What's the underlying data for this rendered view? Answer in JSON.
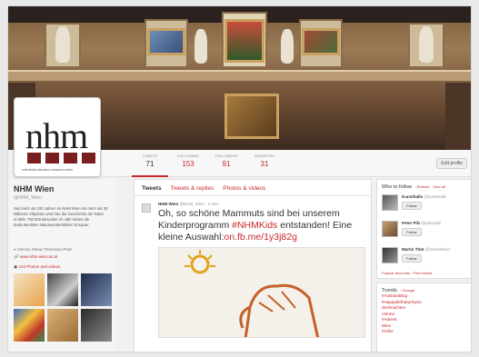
{
  "header": {
    "photo": "museum-hall-header-photo"
  },
  "logo": {
    "text": "nhm",
    "tagline": "naturhistorisches museum wien"
  },
  "stats": [
    {
      "label": "Tweets",
      "value": "71"
    },
    {
      "label": "Following",
      "value": "153"
    },
    {
      "label": "Followers",
      "value": "91"
    },
    {
      "label": "Favorites",
      "value": "31"
    }
  ],
  "edit_profile_label": "Edit profile",
  "profile": {
    "name": "NHM Wien",
    "handle": "@NHM_Wien",
    "bio": "Seit mehr als 100 Jahren im NHM Wien mit mehr als 30 Millionen Objekten wird hier die Geschichte der Natur erzählt. 750.000 Besucher im Jahr testen die bedeutendsten Naturwunderstätten Europas.",
    "location": "Vienna, Maria-Theresien-Platz",
    "website": "www.nhm-wien.ac.at",
    "media_link": "153 Photos and videos"
  },
  "tabs": [
    "Tweets",
    "Tweets & replies",
    "Photos & videos"
  ],
  "tweet": {
    "author": "NHM Wien",
    "handle": "@NHM_Wien · 5 Dec",
    "text_before": "Oh, so schöne Mammuts sind bei unserem Kinderprogramm ",
    "hashtag": "#NHMKids",
    "text_middle": " entstanden! Eine kleine Auswahl:",
    "link": "on.fb.me/1y3j82g"
  },
  "who_to_follow": {
    "title": "Who to follow",
    "actions": "· Refresh · View all",
    "follow_label": "Follow",
    "items": [
      {
        "name": "Kunsthalle",
        "handle": "@kunsthalle"
      },
      {
        "name": "Peter Pilz",
        "handle": "@peterpilz"
      },
      {
        "name": "Martin Thür",
        "handle": "@martinthuer"
      }
    ],
    "footer": "Popular accounts · Find friends"
  },
  "trends": {
    "title": "Trends",
    "change": "· Change",
    "items": [
      "#AustrianBlog",
      "#HappyBirthdayTaylor",
      "Weihnachten",
      "Vienna",
      "#Advent",
      "Wien",
      "#Chile"
    ]
  },
  "colors": {
    "accent": "#c8282c",
    "logo_squares": "#7a1f1f"
  }
}
